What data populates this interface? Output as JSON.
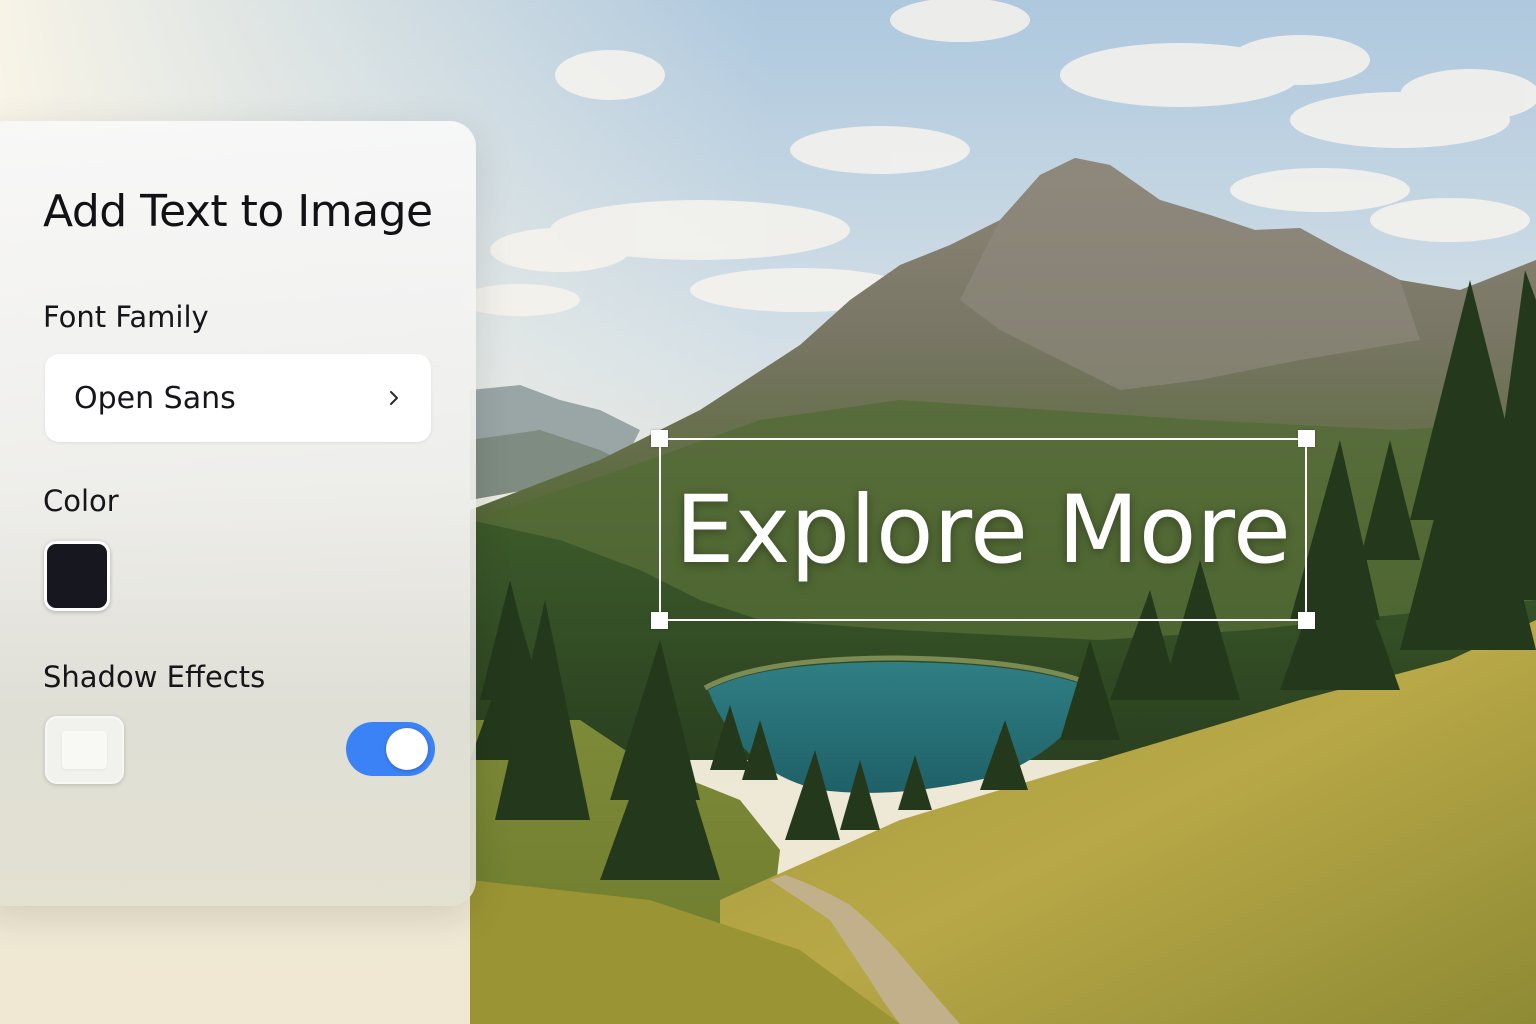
{
  "panel": {
    "title": "Add Text to Image",
    "font_family": {
      "label": "Font Family",
      "value": "Open Sans",
      "icon": "chevron-right-icon"
    },
    "color": {
      "label": "Color",
      "value": "#17171f"
    },
    "shadow": {
      "label": "Shadow Effects",
      "enabled": true
    }
  },
  "canvas": {
    "text": "Explore More",
    "text_color": "#ffffff"
  },
  "colors": {
    "accent": "#3b82f6"
  }
}
